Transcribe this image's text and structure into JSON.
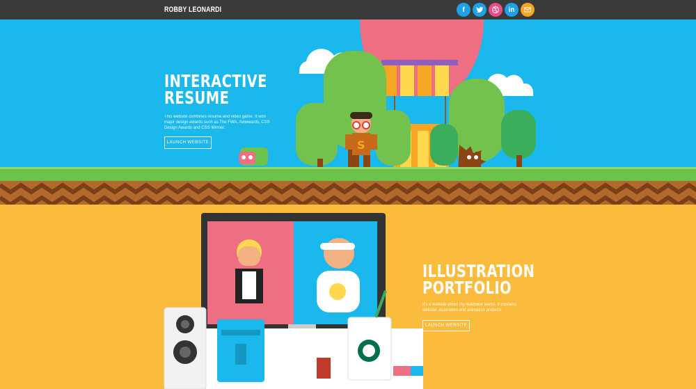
{
  "brand": {
    "name": "ROBBY LEONARDI"
  },
  "social": [
    {
      "name": "facebook-icon",
      "glyph": "f",
      "color": "#1ea1e6"
    },
    {
      "name": "twitter-icon",
      "glyph": "t",
      "color": "#1ea1e6"
    },
    {
      "name": "dribbble-icon",
      "glyph": "d",
      "color": "#ea4c89"
    },
    {
      "name": "linkedin-icon",
      "glyph": "in",
      "color": "#1ea1e6"
    },
    {
      "name": "email-icon",
      "glyph": "@",
      "color": "#f5a623"
    }
  ],
  "sections": [
    {
      "title_line1": "INTERACTIVE",
      "title_line2": "RESUME",
      "description": "This website combines resume and video game. It won major design awards such as The FWA, Awwwards, CSS Design Awards and CSS Winner.",
      "button": "LAUNCH WEBSITE",
      "bg": "#1ab8ec"
    },
    {
      "title_line1": "ILLUSTRATION",
      "title_line2": "PORTFOLIO",
      "description": "It's a website about my illustrator works. It contains website, illustration and animation projects.",
      "button": "LAUNCH WEBSITE",
      "bg": "#fbbc3d"
    }
  ],
  "colors": {
    "topbar": "#3a3a3a",
    "sky": "#1ab8ec",
    "grass": "#6cc24a",
    "dirt": "#8b4513",
    "yellow": "#fbbc3d"
  }
}
